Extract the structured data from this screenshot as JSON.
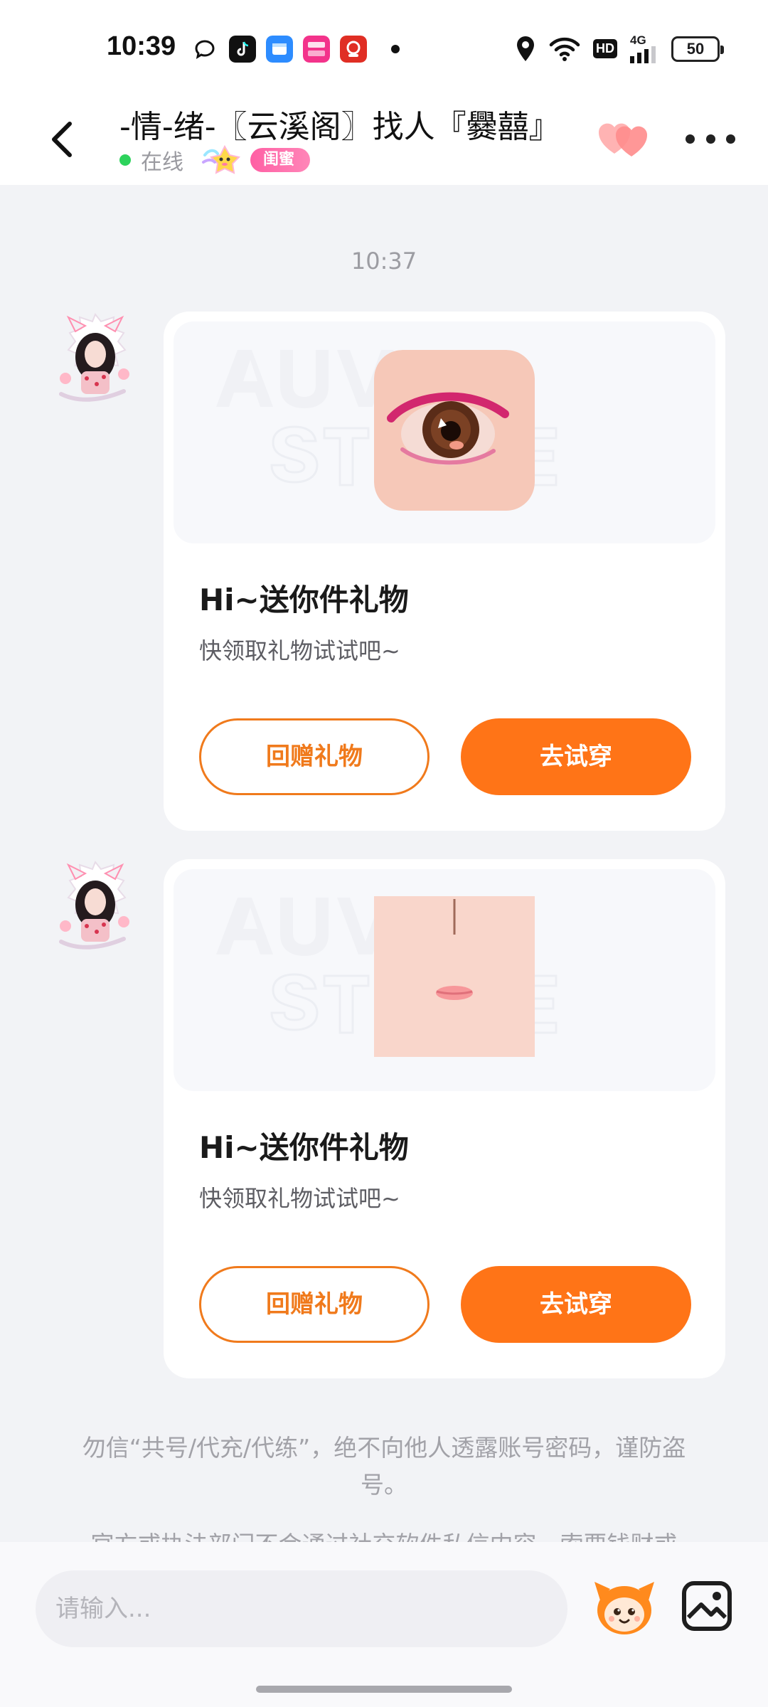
{
  "status_bar": {
    "time": "10:39",
    "battery": "50",
    "network": "4G",
    "hd": "HD",
    "app_icons": [
      "chat-bubble-icon",
      "tiktok-icon",
      "blue-app-icon",
      "vipshop-icon",
      "pinduoduo-icon"
    ]
  },
  "header": {
    "title": "-情-绪-〖云溪阁〗找人『爨囍』",
    "online_status": "在线",
    "relation_badge": "闺蜜"
  },
  "chat": {
    "timestamp": "10:37",
    "gift_messages": [
      {
        "item": "eye",
        "title": "Hi~送你件礼物",
        "description": "快领取礼物试试吧~",
        "return_button": "回赠礼物",
        "try_button": "去试穿"
      },
      {
        "item": "mouth",
        "title": "Hi~送你件礼物",
        "description": "快领取礼物试试吧~",
        "return_button": "回赠礼物",
        "try_button": "去试穿"
      }
    ],
    "notices": [
      "勿信“共号/代充/代练”，绝不向他人透露账号密码，谨防盗号。",
      "官方或执法部门不会通过社交软件私信内容，索要钱财或"
    ]
  },
  "input": {
    "placeholder": "请输入..."
  },
  "colors": {
    "accent": "#ff7417",
    "online": "#2dd35c",
    "badge": "#ff5fa4"
  }
}
